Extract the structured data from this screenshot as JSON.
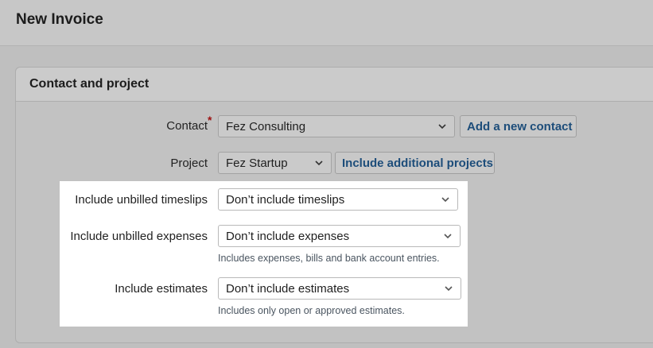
{
  "page": {
    "title": "New Invoice"
  },
  "panel": {
    "title": "Contact and project"
  },
  "contact": {
    "label": "Contact",
    "required_marker": "*",
    "value": "Fez Consulting",
    "add_button": "Add a new contact"
  },
  "project": {
    "label": "Project",
    "value": "Fez Startup",
    "include_button": "Include additional projects"
  },
  "timeslips": {
    "label": "Include unbilled timeslips",
    "value": "Don’t include timeslips"
  },
  "expenses": {
    "label": "Include unbilled expenses",
    "value": "Don’t include expenses",
    "hint": "Includes expenses, bills and bank account entries."
  },
  "estimates": {
    "label": "Include estimates",
    "value": "Don’t include estimates",
    "hint": "Includes only open or approved estimates."
  },
  "icons": {
    "dropdown": "chevron-down-icon"
  },
  "colors": {
    "link_blue": "#1d4d7a",
    "required_red": "#9c1010",
    "highlight": "#ffffff"
  }
}
